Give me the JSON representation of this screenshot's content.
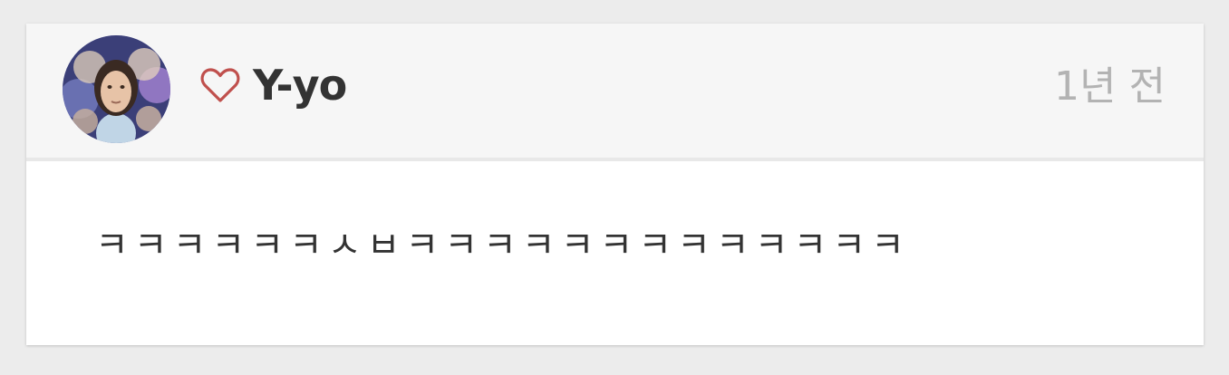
{
  "comment": {
    "author": "Y-yo",
    "timestamp": "1년 전",
    "text": "ㅋㅋㅋㅋㅋㅋㅅㅂㅋㅋㅋㅋㅋㅋㅋㅋㅋㅋㅋㅋㅋ",
    "avatar_icon": "user-avatar",
    "like_icon": "heart-outline-icon",
    "like_color": "#c0504d"
  }
}
